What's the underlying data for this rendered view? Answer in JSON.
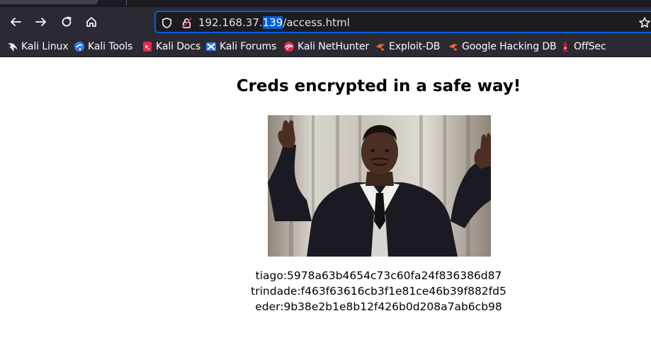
{
  "browser": {
    "url": {
      "host_prefix": "192.168.37.",
      "host_selected": "139",
      "path": "/access.html"
    },
    "bookmarks": [
      {
        "label": "Kali Linux",
        "icon": "kali-dragon-icon"
      },
      {
        "label": "Kali Tools",
        "icon": "kali-tools-icon"
      },
      {
        "label": "Kali Docs",
        "icon": "kali-docs-icon"
      },
      {
        "label": "Kali Forums",
        "icon": "kali-forums-icon"
      },
      {
        "label": "Kali NetHunter",
        "icon": "kali-nethunter-icon"
      },
      {
        "label": "Exploit-DB",
        "icon": "exploit-db-icon"
      },
      {
        "label": "Google Hacking DB",
        "icon": "ghdb-icon"
      },
      {
        "label": "OffSec",
        "icon": "offsec-icon"
      }
    ]
  },
  "page": {
    "heading": "Creds encrypted in a safe way!",
    "credentials": [
      "tiago:5978a63b4654c73c60fa24f836386d87",
      "trindade:f463f63616cb3f1e81ce46b39f882fd5",
      "eder:9b38e2b1e8b12f426b0d208a7ab6cb98"
    ]
  },
  "colors": {
    "chrome_bg": "#2b2a33",
    "urlbar_bg": "#1c1b22",
    "focus_ring": "#0060df",
    "page_bg": "#ffffff"
  }
}
